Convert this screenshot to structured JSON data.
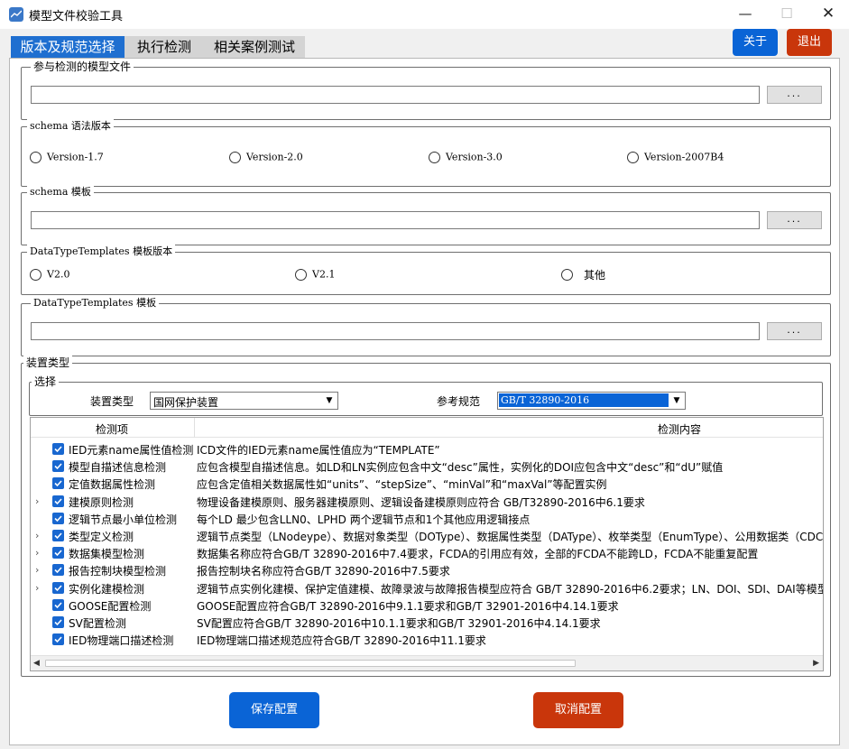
{
  "window": {
    "title": "模型文件校验工具",
    "minimize": "—",
    "maximize": "☐",
    "close": "✕"
  },
  "tabs": [
    {
      "label": "版本及规范选择",
      "active": true
    },
    {
      "label": "执行检测",
      "active": false
    },
    {
      "label": "相关案例测试",
      "active": false
    }
  ],
  "header_buttons": {
    "about": "关于",
    "exit": "退出"
  },
  "colors": {
    "accent_blue": "#0a64d6",
    "exit_red": "#c9360b",
    "checkbox_blue": "#1867d0"
  },
  "model_file": {
    "legend": "参与检测的模型文件",
    "value": "",
    "browse_label": "..."
  },
  "schema_version": {
    "legend": "schema  语法版本",
    "options": [
      "Version-1.7",
      "Version-2.0",
      "Version-3.0",
      "Version-2007B4"
    ]
  },
  "schema_template": {
    "legend": "schema 模板",
    "value": "",
    "browse_label": "..."
  },
  "dtt_version": {
    "legend": "DataTypeTemplates 模板版本",
    "options": [
      "V2.0",
      "V2.1",
      "其他"
    ]
  },
  "dtt_template": {
    "legend": "DataTypeTemplates 模板",
    "value": "",
    "browse_label": "..."
  },
  "device": {
    "legend": "装置类型",
    "select_legend": "选择",
    "device_type_label": "装置类型",
    "device_type_value": "国网保护装置",
    "ref_std_label": "参考规范",
    "ref_std_value": "GB/T 32890-2016"
  },
  "tree": {
    "columns": [
      "检测项",
      "检测内容"
    ],
    "rows": [
      {
        "expandable": false,
        "checked": true,
        "label": "IED元素name属性值检测",
        "content": "ICD文件的IED元素name属性值应为“TEMPLATE”"
      },
      {
        "expandable": false,
        "checked": true,
        "label": "模型自描述信息检测",
        "content": "应包含模型自描述信息。如LD和LN实例应包含中文“desc”属性，实例化的DOI应包含中文“desc”和“dU”赋值"
      },
      {
        "expandable": false,
        "checked": true,
        "label": "定值数据属性检测",
        "content": "应包含定值相关数据属性如“units”、“stepSize”、“minVal”和“maxVal”等配置实例"
      },
      {
        "expandable": true,
        "checked": true,
        "label": "建模原则检测",
        "content": "物理设备建模原则、服务器建模原则、逻辑设备建模原则应符合 GB/T32890-2016中6.1要求"
      },
      {
        "expandable": false,
        "checked": true,
        "label": "逻辑节点最小单位检测",
        "content": "每个LD 最少包含LLN0、LPHD 两个逻辑节点和1个其他应用逻辑接点"
      },
      {
        "expandable": true,
        "checked": true,
        "label": "类型定义检测",
        "content": "逻辑节点类型（LNodeype）、数据对象类型（DOType）、数据属性类型（DAType）、枚举类型（EnumType）、公用数据类（CDC）"
      },
      {
        "expandable": true,
        "checked": true,
        "label": "数据集模型检测",
        "content": "数据集名称应符合GB/T 32890-2016中7.4要求，FCDA的引用应有效，全部的FCDA不能跨LD，FCDA不能重复配置"
      },
      {
        "expandable": true,
        "checked": true,
        "label": "报告控制块模型检测",
        "content": "报告控制块名称应符合GB/T 32890-2016中7.5要求"
      },
      {
        "expandable": true,
        "checked": true,
        "label": "实例化建模检测",
        "content": "逻辑节点实例化建模、保护定值建模、故障录波与故障报告模型应符合 GB/T 32890-2016中6.2要求；LN、DOI、SDI、DAI等模型实例"
      },
      {
        "expandable": false,
        "checked": true,
        "label": "GOOSE配置检测",
        "content": "GOOSE配置应符合GB/T 32890-2016中9.1.1要求和GB/T 32901-2016中4.14.1要求"
      },
      {
        "expandable": false,
        "checked": true,
        "label": "SV配置检测",
        "content": "SV配置应符合GB/T 32890-2016中10.1.1要求和GB/T 32901-2016中4.14.1要求"
      },
      {
        "expandable": false,
        "checked": true,
        "label": "IED物理端口描述检测",
        "content": "IED物理端口描述规范应符合GB/T 32890-2016中11.1要求"
      }
    ]
  },
  "actions": {
    "save": "保存配置",
    "cancel": "取消配置"
  }
}
